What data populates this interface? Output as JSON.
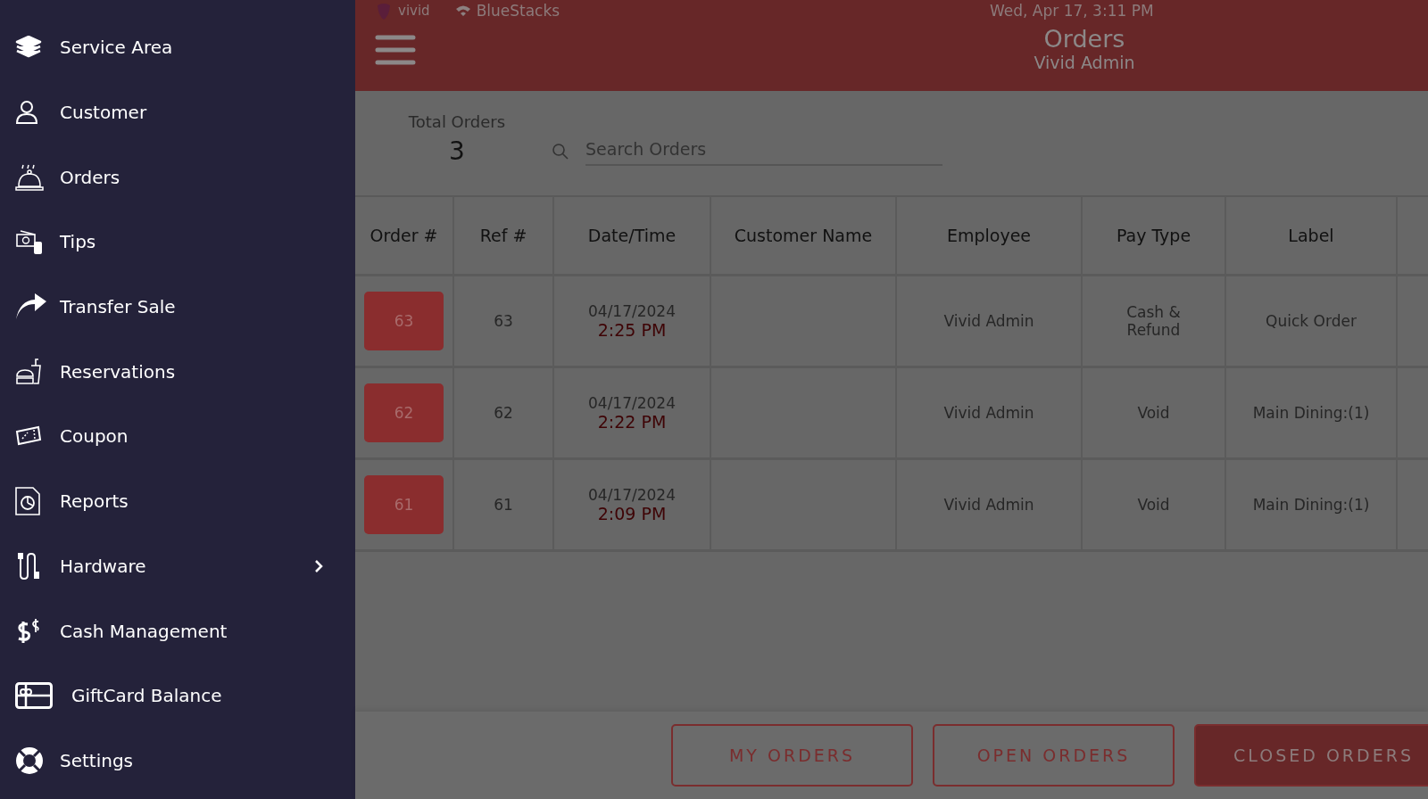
{
  "sidebar": {
    "items": [
      {
        "label": "Service Area",
        "has_submenu": false
      },
      {
        "label": "Customer",
        "has_submenu": false
      },
      {
        "label": "Orders",
        "has_submenu": false
      },
      {
        "label": "Tips",
        "has_submenu": false
      },
      {
        "label": "Transfer Sale",
        "has_submenu": false
      },
      {
        "label": "Reservations",
        "has_submenu": false
      },
      {
        "label": "Coupon",
        "has_submenu": false
      },
      {
        "label": "Reports",
        "has_submenu": false
      },
      {
        "label": "Hardware",
        "has_submenu": true
      },
      {
        "label": "Cash Management",
        "has_submenu": false
      },
      {
        "label": "GiftCard Balance",
        "has_submenu": false
      },
      {
        "label": "Settings",
        "has_submenu": false
      }
    ]
  },
  "status_bar": {
    "app_name": "vivid",
    "network": "BlueStacks",
    "datetime": "Wed, Apr 17, 3:11 PM"
  },
  "header": {
    "title": "Orders",
    "subtitle": "Vivid Admin"
  },
  "summary": {
    "label": "Total Orders",
    "value": "3"
  },
  "search": {
    "placeholder": "Search Orders"
  },
  "table": {
    "columns": [
      "Order #",
      "Ref #",
      "Date/Time",
      "Customer Name",
      "Employee",
      "Pay Type",
      "Label"
    ],
    "rows": [
      {
        "order": "63",
        "ref": "63",
        "date": "04/17/2024",
        "time": "2:25 PM",
        "employee": "Vivid Admin",
        "pay_type": "Cash & Refund",
        "label": "Quick Order"
      },
      {
        "order": "62",
        "ref": "62",
        "date": "04/17/2024",
        "time": "2:22 PM",
        "employee": "Vivid Admin",
        "pay_type": "Void",
        "label": "Main Dining:(1)"
      },
      {
        "order": "61",
        "ref": "61",
        "date": "04/17/2024",
        "time": "2:09 PM",
        "employee": "Vivid Admin",
        "pay_type": "Void",
        "label": "Main Dining:(1)"
      }
    ]
  },
  "filter_tabs": [
    {
      "label": "MY ORDERS",
      "selected": false
    },
    {
      "label": "OPEN ORDERS",
      "selected": false
    },
    {
      "label": "CLOSED ORDERS",
      "selected": true
    }
  ]
}
